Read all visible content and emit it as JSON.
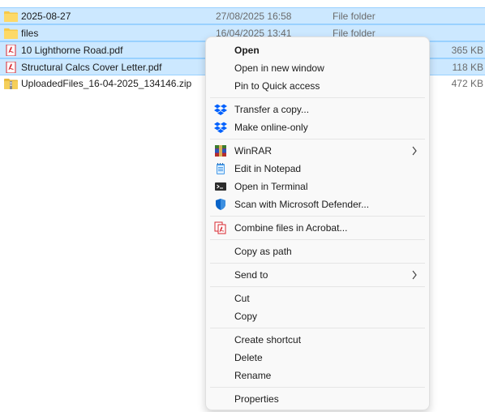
{
  "files": [
    {
      "name": "2025-08-27",
      "date": "27/08/2025 16:58",
      "type": "File folder",
      "size": "",
      "icon": "folder-icon",
      "selected": true
    },
    {
      "name": "files",
      "date": "16/04/2025 13:41",
      "type": "File folder",
      "size": "",
      "icon": "folder-icon",
      "selected": true
    },
    {
      "name": "10 Lighthorne Road.pdf",
      "date": "",
      "type": "",
      "size": "365 KB",
      "icon": "pdf-icon",
      "selected": true
    },
    {
      "name": "Structural Calcs Cover Letter.pdf",
      "date": "",
      "type": "",
      "size": "118 KB",
      "icon": "pdf-icon",
      "selected": true
    },
    {
      "name": "UploadedFiles_16-04-2025_134146.zip",
      "date": "",
      "type": "",
      "size": "472 KB",
      "icon": "zip-folder-icon",
      "selected": false
    }
  ],
  "menu": {
    "open": "Open",
    "open_new_window": "Open in new window",
    "pin_quick_access": "Pin to Quick access",
    "transfer_copy": "Transfer a copy...",
    "make_online_only": "Make online-only",
    "winrar": "WinRAR",
    "edit_notepad": "Edit in Notepad",
    "open_terminal": "Open in Terminal",
    "scan_defender": "Scan with Microsoft Defender...",
    "combine_acrobat": "Combine files in Acrobat...",
    "copy_as_path": "Copy as path",
    "send_to": "Send to",
    "cut": "Cut",
    "copy": "Copy",
    "create_shortcut": "Create shortcut",
    "delete": "Delete",
    "rename": "Rename",
    "properties": "Properties",
    "submenu_arrow": ">"
  },
  "colors": {
    "selection": "#cce8ff",
    "selection_border": "#99d1ff",
    "folder": "#f7c948",
    "pdf": "#d7262e",
    "dropbox": "#0061fe",
    "defender": "#0a64c8"
  }
}
